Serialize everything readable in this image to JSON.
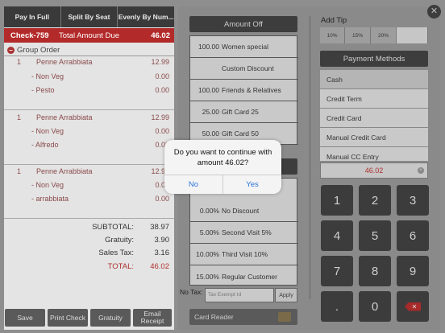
{
  "split_tabs": [
    "Pay In Full",
    "Split By Seat",
    "Evenly By Num..."
  ],
  "check": {
    "id": "Check-759",
    "label": "Total Amount Due",
    "amount": "46.02"
  },
  "group_label": "Group Order",
  "items": [
    {
      "qty": "1",
      "name": "Penne Arrabbiata",
      "price": "12.99",
      "mods": [
        {
          "name": "- Non Veg",
          "price": "0.00"
        },
        {
          "name": "- Pesto",
          "price": "0.00"
        }
      ]
    },
    {
      "qty": "1",
      "name": "Penne Arrabbiata",
      "price": "12.99",
      "mods": [
        {
          "name": "- Non Veg",
          "price": "0.00"
        },
        {
          "name": "- Alfredo",
          "price": "0.00"
        }
      ]
    },
    {
      "qty": "1",
      "name": "Penne Arrabbiata",
      "price": "12.99",
      "mods": [
        {
          "name": "- Non Veg",
          "price": "0.00"
        },
        {
          "name": "- arrabbiata",
          "price": "0.00"
        }
      ]
    }
  ],
  "totals": [
    {
      "label": "SUBTOTAL:",
      "value": "38.97"
    },
    {
      "label": "Gratuity:",
      "value": "3.90"
    },
    {
      "label": "Sales Tax:",
      "value": "3.16"
    },
    {
      "label": "TOTAL:",
      "value": "46.02"
    }
  ],
  "left_buttons": [
    "Save",
    "Print Check",
    "Gratuity",
    "Email Receipt"
  ],
  "amount_off": {
    "header": "Amount Off",
    "rows": [
      {
        "value": "100.00",
        "name": "Women special"
      },
      {
        "value": "",
        "name": "Custom Discount"
      },
      {
        "value": "100.00",
        "name": "Friends & Relatives"
      },
      {
        "value": "25.00",
        "name": "Gift Card 25"
      },
      {
        "value": "50.00",
        "name": "Gift Card 50"
      }
    ]
  },
  "percent_off": {
    "rows": [
      {
        "value": "0.00%",
        "name": "No Discount"
      },
      {
        "value": "5.00%",
        "name": "Second Visit 5%"
      },
      {
        "value": "10.00%",
        "name": "Third Visit 10%"
      },
      {
        "value": "15.00%",
        "name": "Regular Customer"
      }
    ]
  },
  "no_tax_label": "No Tax:",
  "tax_exempt_placeholder": "Tax Exempt Id",
  "apply_label": "Apply",
  "card_reader_label": "Card Reader",
  "tip": {
    "label": "Add Tip",
    "options": [
      "10%",
      "15%",
      "20%"
    ]
  },
  "payment_methods": {
    "header": "Payment Methods",
    "items": [
      "Cash",
      "Credit Term",
      "Credit Card",
      "Manual Credit Card",
      "Manual CC Entry"
    ],
    "selected": "Cash"
  },
  "amount_field": "46.02",
  "keypad": [
    "1",
    "2",
    "3",
    "4",
    "5",
    "6",
    "7",
    "8",
    "9",
    ".",
    "0"
  ],
  "dialog": {
    "message_line1": "Do you want to continue with",
    "message_line2": "amount 46.02?",
    "no_label": "No",
    "yes_label": "Yes"
  },
  "colors": {
    "accent_red": "#b32a2a",
    "link_blue": "#2a73d8",
    "panel_dark": "#3d3d3d"
  },
  "icons": {
    "close": "close-icon",
    "delete": "backspace-icon",
    "clear": "clear-icon",
    "card": "card-reader-icon",
    "group": "minus-circle-icon"
  }
}
